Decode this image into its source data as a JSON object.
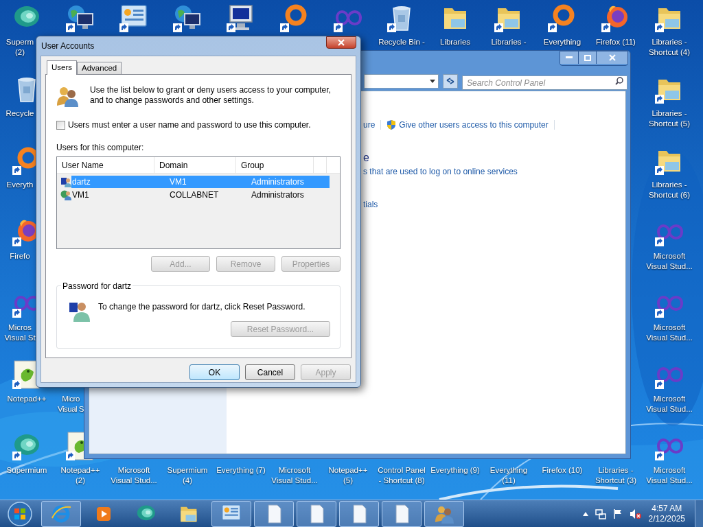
{
  "desktop": {
    "icons": [
      {
        "kind": "blob",
        "shortcut": false,
        "label": "Superm\n(2)"
      },
      {
        "kind": "globe-monitor",
        "shortcut": true
      },
      {
        "kind": "panel",
        "shortcut": true
      },
      {
        "kind": "globe-monitor",
        "shortcut": true
      },
      {
        "kind": "monitor",
        "shortcut": true
      },
      {
        "kind": "ring",
        "shortcut": true
      },
      {
        "kind": "infinity",
        "shortcut": true
      },
      {
        "kind": "recycle",
        "shortcut": true,
        "label": "Recycle Bin -"
      },
      {
        "kind": "folder",
        "shortcut": false,
        "label": "Libraries"
      },
      {
        "kind": "folder",
        "shortcut": true,
        "label": "Libraries -"
      },
      {
        "kind": "ring",
        "shortcut": true,
        "label": "Everything"
      },
      {
        "kind": "firefox",
        "shortcut": true,
        "label": "Firefox (11)"
      },
      {
        "kind": "folder",
        "shortcut": true,
        "label": "Libraries -\nShortcut (4)"
      },
      {
        "kind": "recycle",
        "shortcut": false,
        "label": "Recycle"
      },
      {
        "kind": "folder",
        "shortcut": true,
        "label": "Libraries -\nShortcut (5)"
      },
      {
        "kind": "ring",
        "shortcut": true,
        "label": "Everyth"
      },
      {
        "kind": "folder",
        "shortcut": true,
        "label": "Libraries -\nShortcut (6)"
      },
      {
        "kind": "firefox",
        "shortcut": true,
        "label": "Firefo"
      },
      {
        "kind": "infinity",
        "shortcut": true,
        "label": "Microsoft\nVisual Stud..."
      },
      {
        "kind": "infinity",
        "shortcut": true,
        "label": "Micros\nVisual St"
      },
      {
        "kind": "infinity",
        "shortcut": true,
        "label": "Microsoft\nVisual Stud..."
      },
      {
        "kind": "notepad",
        "shortcut": true,
        "label": "Notepad++"
      },
      {
        "label": "Micro\nVisual S"
      },
      {
        "kind": "infinity",
        "shortcut": true,
        "label": "Microsoft\nVisual Stud..."
      },
      {
        "kind": "blob",
        "shortcut": true,
        "label": "Supermium"
      },
      {
        "kind": "notepad",
        "shortcut": true,
        "label": "Notepad++\n(2)"
      },
      {
        "label": "Microsoft\nVisual Stud..."
      },
      {
        "label": "Supermium\n(4)"
      },
      {
        "label": "Everything (7)"
      },
      {
        "label": "Microsoft\nVisual Stud..."
      },
      {
        "label": "Notepad++\n(5)"
      },
      {
        "label": "Control Panel\n- Shortcut (8)"
      },
      {
        "label": "Everything (9)"
      },
      {
        "label": "Everything\n(11)"
      },
      {
        "label": "Firefox (10)"
      },
      {
        "label": "Libraries -\nShortcut (3)"
      },
      {
        "kind": "infinity",
        "shortcut": true,
        "label": "Microsoft\nVisual Stud..."
      }
    ]
  },
  "control_panel_window": {
    "search": {
      "placeholder": "Search Control Panel"
    },
    "task_links": [
      {
        "text": "ure",
        "shield": false
      },
      {
        "text": "Give other users access to this computer",
        "shield": true
      }
    ],
    "section": {
      "heading": "e",
      "links": [
        "s that are used to log on to online services",
        "tials"
      ]
    }
  },
  "dialog": {
    "title": "User Accounts",
    "tabs": [
      {
        "label": "Users",
        "selected": true
      },
      {
        "label": "Advanced",
        "selected": false
      }
    ],
    "intro": "Use the list below to grant or deny users access to your computer,\nand to change passwords and other settings.",
    "require_password": {
      "label": "Users must enter a user name and password to use this computer.",
      "checked": false
    },
    "users_label": "Users for this computer:",
    "table": {
      "columns": [
        "User Name",
        "Domain",
        "Group"
      ],
      "rows": [
        {
          "kind": "local",
          "selected": true,
          "cells": [
            "dartz",
            "VM1",
            "Administrators"
          ]
        },
        {
          "kind": "domain",
          "selected": false,
          "cells": [
            "VM1",
            "COLLABNET",
            "Administrators"
          ]
        }
      ]
    },
    "list_buttons": [
      {
        "label": "Add...",
        "disabled": true
      },
      {
        "label": "Remove",
        "disabled": true
      },
      {
        "label": "Properties",
        "disabled": true
      }
    ],
    "password_group": {
      "title": "Password for dartz",
      "text": "To change the password for dartz, click Reset Password.",
      "button": {
        "label": "Reset Password...",
        "disabled": true
      }
    },
    "buttons": [
      {
        "label": "OK",
        "disabled": false,
        "default": true
      },
      {
        "label": "Cancel",
        "disabled": false,
        "default": false
      },
      {
        "label": "Apply",
        "disabled": true,
        "default": false
      }
    ]
  },
  "taskbar": {
    "buttons": [
      {
        "kind": "ie",
        "open": true
      },
      {
        "kind": "media",
        "open": false
      },
      {
        "kind": "blob",
        "open": false
      },
      {
        "kind": "folder",
        "open": false
      },
      {
        "kind": "panel",
        "open": true
      },
      {
        "kind": "page",
        "open": true
      },
      {
        "kind": "page",
        "open": true
      },
      {
        "kind": "page",
        "open": true
      },
      {
        "kind": "page",
        "open": true
      },
      {
        "kind": "users",
        "open": true
      }
    ],
    "clock": {
      "time": "4:57 AM",
      "date": "2/12/2025"
    }
  }
}
